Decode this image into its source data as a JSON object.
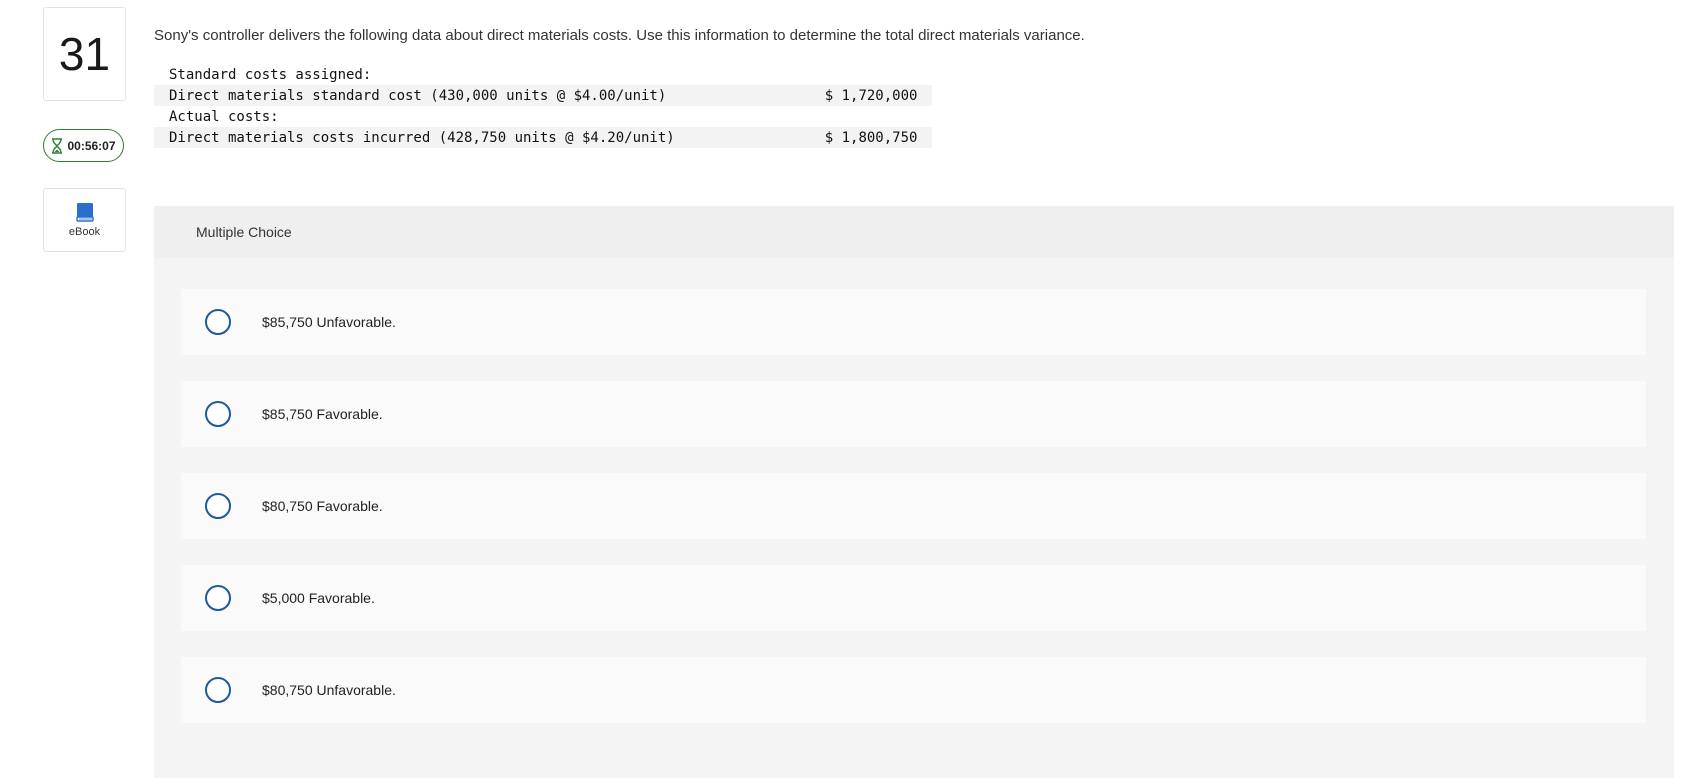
{
  "question": {
    "number": "31",
    "timer": "00:56:07",
    "ebook_label": "eBook",
    "prompt": "Sony's controller delivers the following data about direct materials costs. Use this information to determine the total direct materials variance."
  },
  "cost_table": {
    "rows": [
      {
        "label": "Standard costs assigned:",
        "amount": ""
      },
      {
        "label": "Direct materials standard cost (430,000 units @ $4.00/unit)",
        "amount": "$ 1,720,000"
      },
      {
        "label": "Actual costs:",
        "amount": ""
      },
      {
        "label": "Direct materials costs incurred (428,750 units @ $4.20/unit)",
        "amount": "$ 1,800,750"
      }
    ]
  },
  "multiple_choice": {
    "header": "Multiple Choice",
    "options": [
      {
        "label": "$85,750 Unfavorable.",
        "selected": false
      },
      {
        "label": "$85,750 Favorable.",
        "selected": false
      },
      {
        "label": "$80,750 Favorable.",
        "selected": false
      },
      {
        "label": "$5,000 Favorable.",
        "selected": false
      },
      {
        "label": "$80,750 Unfavorable.",
        "selected": false
      }
    ]
  },
  "colors": {
    "timer_border": "#2e7d32",
    "radio_border": "#1d5a9c",
    "ebook_icon": "#2a6fc9"
  },
  "icons": {
    "timer": "hourglass-icon",
    "ebook": "book-icon"
  }
}
